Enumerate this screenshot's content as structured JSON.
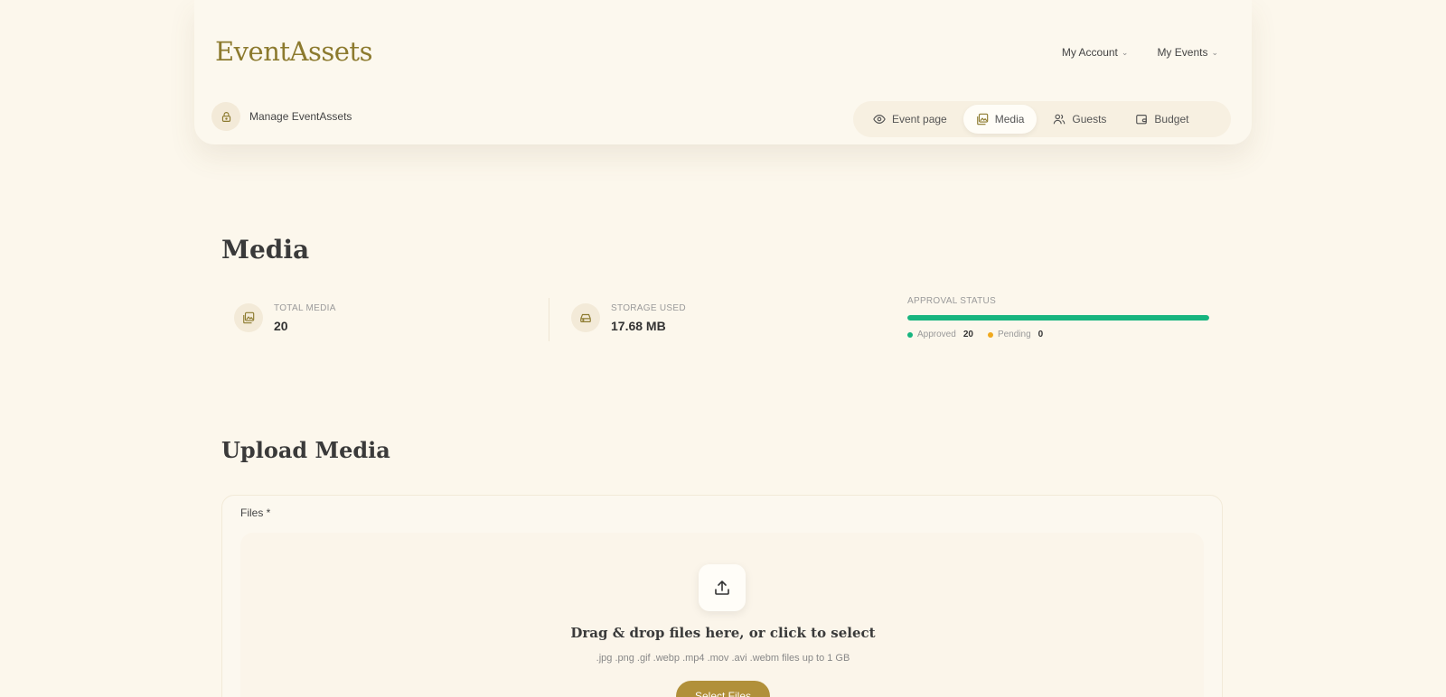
{
  "brand": {
    "logo": "EventAssets"
  },
  "top_nav": {
    "account": "My Account",
    "events": "My Events"
  },
  "manage": {
    "label": "Manage EventAssets"
  },
  "tabs": [
    {
      "label": "Event page",
      "icon": "eye-icon",
      "active": false
    },
    {
      "label": "Media",
      "icon": "images-icon",
      "active": true
    },
    {
      "label": "Guests",
      "icon": "users-icon",
      "active": false
    },
    {
      "label": "Budget",
      "icon": "wallet-icon",
      "active": false
    }
  ],
  "media": {
    "title": "Media",
    "total_media_label": "TOTAL MEDIA",
    "total_media_value": "20",
    "storage_label": "STORAGE USED",
    "storage_value": "17.68 MB",
    "approval_label": "APPROVAL STATUS",
    "approved_label": "Approved",
    "approved_count": "20",
    "pending_label": "Pending",
    "pending_count": "0",
    "approved_fraction": 1.0,
    "colors": {
      "approved": "#17b57f",
      "pending": "#f0a91e"
    }
  },
  "upload": {
    "title": "Upload Media",
    "files_label": "Files *",
    "drop_title": "Drag & drop files here, or click to select",
    "drop_hint": ".jpg .png .gif .webp .mp4 .mov .avi .webm files up to 1 GB",
    "select_button": "Select Files"
  },
  "colors": {
    "accent": "#b1903a",
    "logo": "#8c7a2e",
    "background": "#fcf7ec"
  }
}
